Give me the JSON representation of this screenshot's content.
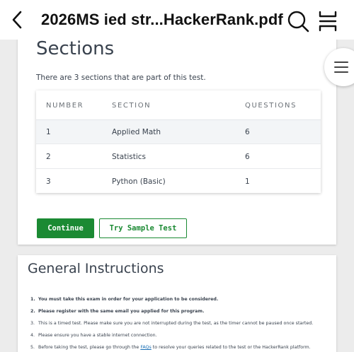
{
  "viewer": {
    "title": "2026MS ied str...HackerRank.pdf"
  },
  "sections": {
    "heading": "Sections",
    "description": "There are 3 sections that are part of this test.",
    "columns": [
      "NUMBER",
      "SECTION",
      "QUESTIONS"
    ],
    "rows": [
      {
        "number": "1",
        "section": "Applied Math",
        "questions": "6"
      },
      {
        "number": "2",
        "section": "Statistics",
        "questions": "6"
      },
      {
        "number": "3",
        "section": "Python (Basic)",
        "questions": "1"
      }
    ],
    "continue_label": "Continue",
    "sample_label": "Try Sample Test"
  },
  "instructions": {
    "heading": "General Instructions",
    "items": [
      {
        "num": "1.",
        "text": "You must take this exam in order for your application to be considered.",
        "bold": true
      },
      {
        "num": "2.",
        "text": "Please register with the same email you applied for this program.",
        "bold": true
      },
      {
        "num": "3.",
        "text": "This is a timed test. Please make sure you are not interrupted during the test, as the timer cannot be paused once started.",
        "bold": false
      },
      {
        "num": "4.",
        "text": "Please ensure you have a stable internet connection.",
        "bold": false
      },
      {
        "num": "5.",
        "before": "Before taking the test, please go through the ",
        "link": "FAQs",
        "after": " to resolve your queries related to the test or the HackerRank platform.",
        "bold": false
      }
    ]
  },
  "colors": {
    "accent_green": "#1b8a33",
    "link_blue": "#1a6fb5",
    "text": "#39424e"
  }
}
